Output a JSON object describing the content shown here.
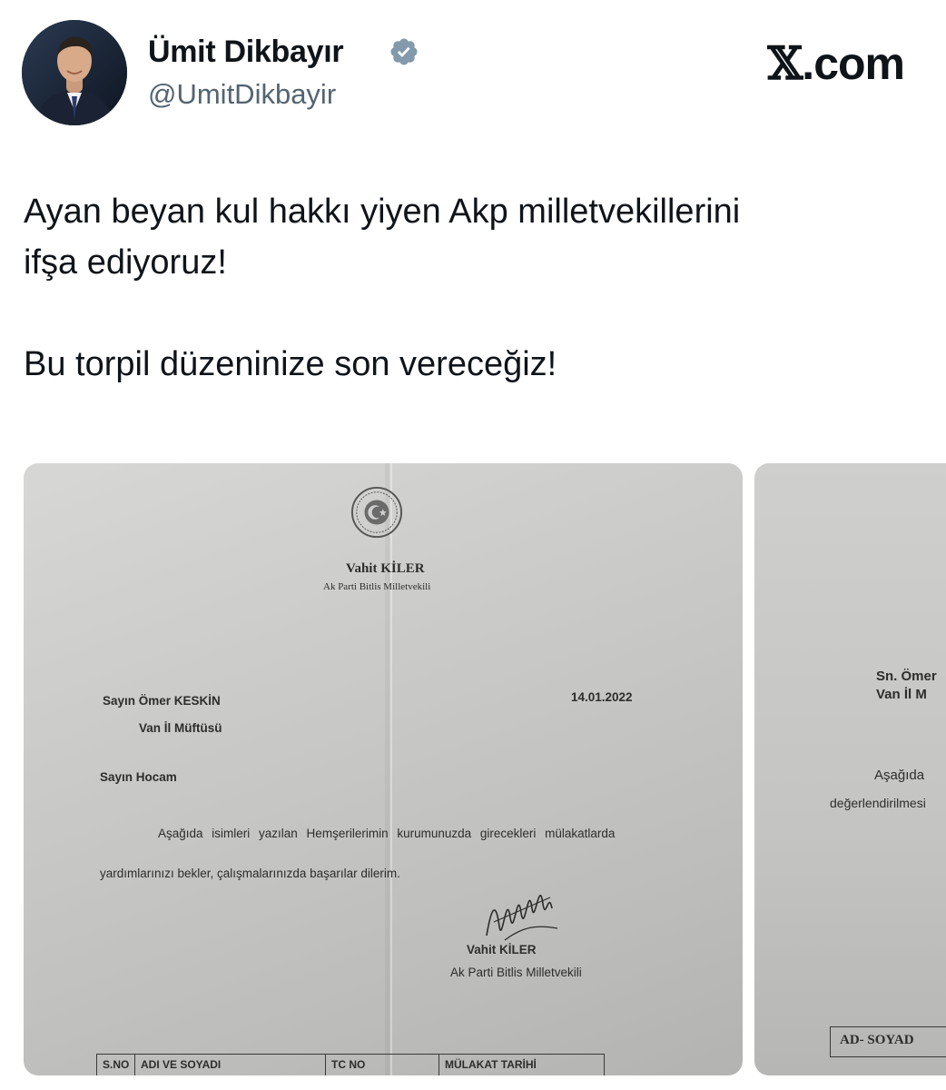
{
  "author": {
    "display_name": "Ümit Dikbayır",
    "handle": "@UmitDikbayir",
    "verified": true
  },
  "brand": {
    "x_mark": "𝕏",
    "domain": ".com"
  },
  "tweet": {
    "text": "Ayan beyan kul hakkı yiyen Akp milletvekillerini\nifşa ediyoruz!\n\nBu torpil düzeninize son vereceğiz!"
  },
  "document_1": {
    "letterhead_name": "Vahit KİLER",
    "letterhead_title": "Ak Parti Bitlis Milletvekili",
    "recipient": "Sayın Ömer KESKİN",
    "recipient_title": "Van İl Müftüsü",
    "date": "14.01.2022",
    "salutation": "Sayın Hocam",
    "body_line_1": "Aşağıda isimleri yazılan Hemşerilerimin kurumunuzda girecekleri mülakatlarda",
    "body_line_2": "yardımlarınızı bekler, çalışmalarınızda başarılar dilerim.",
    "signature_name": "Vahit KİLER",
    "signature_title": "Ak Parti Bitlis Milletvekili",
    "table_headers": [
      "S.NO",
      "ADI VE SOYADI",
      "TC NO",
      "MÜLAKAT TARİHİ"
    ]
  },
  "document_2": {
    "recipient": "Sn. Ömer",
    "recipient_title": "Van İl M",
    "body_line_1": "Aşağıda",
    "body_line_2": "değerlendirilmesi",
    "table_header": "AD- SOYAD"
  },
  "colors": {
    "text": "#0f1419",
    "secondary": "#536471",
    "verified_badge": "#829aab"
  }
}
